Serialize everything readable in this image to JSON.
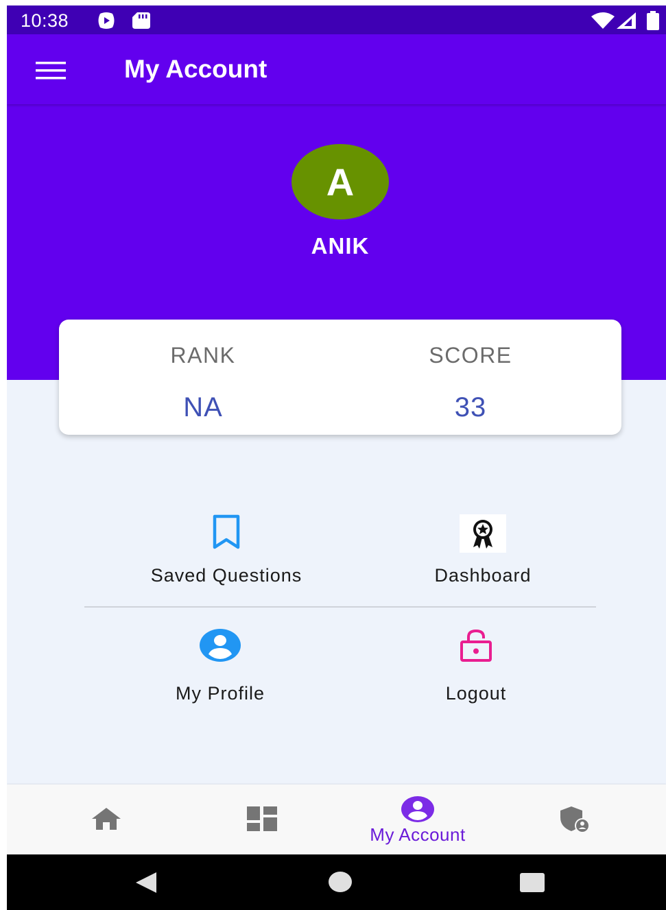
{
  "status_bar": {
    "time": "10:38",
    "icons": [
      "play-protect-icon",
      "sd-card-icon",
      "wifi-icon",
      "signal-icon",
      "battery-icon"
    ]
  },
  "app_bar": {
    "menu_icon": "hamburger-menu-icon",
    "title": "My Account"
  },
  "profile": {
    "avatar_initial": "A",
    "avatar_color": "#679200",
    "name": "ANIK"
  },
  "stats": {
    "rank_label": "RANK",
    "rank_value": "NA",
    "score_label": "SCORE",
    "score_value": "33"
  },
  "menu": {
    "items": [
      {
        "label": "Saved Questions",
        "icon": "bookmark-icon",
        "color": "#2196f3"
      },
      {
        "label": "Dashboard",
        "icon": "award-ribbon-icon",
        "color": "#000000"
      },
      {
        "label": "My Profile",
        "icon": "account-circle-icon",
        "color": "#2196f3"
      },
      {
        "label": "Logout",
        "icon": "lock-open-icon",
        "color": "#e91e90"
      }
    ]
  },
  "bottom_nav": {
    "items": [
      {
        "icon": "home-icon",
        "label": ""
      },
      {
        "icon": "dashboard-icon",
        "label": ""
      },
      {
        "icon": "account-circle-icon",
        "label": "My Account",
        "active": true
      },
      {
        "icon": "shield-account-icon",
        "label": ""
      }
    ],
    "active_color": "#6a1bd8",
    "inactive_color": "#757575"
  },
  "system_nav": {
    "icons": [
      "back-icon",
      "home-circle-icon",
      "recents-icon"
    ]
  },
  "colors": {
    "primary": "#6200ee",
    "status_bar": "#3f00b4",
    "background": "#eef3fb",
    "stat_value": "#3f51b5"
  }
}
